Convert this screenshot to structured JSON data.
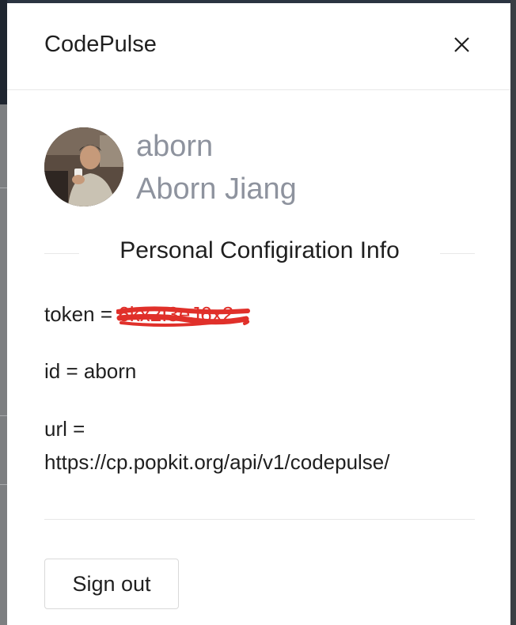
{
  "drawer": {
    "title": "CodePulse",
    "close_icon": "close-icon"
  },
  "profile": {
    "username": "aborn",
    "full_name": "Aborn Jiang",
    "avatar_icon": "user-avatar-photo"
  },
  "section": {
    "title": "Personal Configiration Info"
  },
  "config": {
    "token_label": "token = ",
    "token_value": "6kx2I3eJ6x2",
    "token_redacted": true,
    "id_line": "id = aborn",
    "url_label": "url =",
    "url_value": "https://cp.popkit.org/api/v1/codepulse/"
  },
  "actions": {
    "sign_out_label": "Sign out"
  },
  "colors": {
    "muted_text": "#8e939e",
    "redaction": "#e0302a",
    "divider": "#e8e8e8"
  }
}
